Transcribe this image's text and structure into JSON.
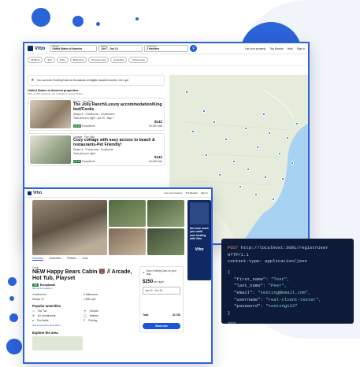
{
  "win1": {
    "logo": "Vrbo",
    "where_label": "Where",
    "where_value": "United States of America",
    "dates_label": "Dates",
    "dates_value": "Jun 7 - Jun 14",
    "travelers_label": "Travelers",
    "travelers_value": "2 travelers",
    "nav": [
      "List your property",
      "Trip Boards",
      "Help",
      "Sign in"
    ],
    "filters": [
      "All filters",
      "Sort",
      "Price",
      "Bedrooms",
      "Property type",
      "Amenities",
      "Instant book"
    ],
    "promo": "You can earn OneKeyCash on thousands of eligible vacation homes. Let's go!",
    "result_title": "United States of America properties",
    "result_sub": "300+ of 300 properties are available in United States",
    "cards": [
      {
        "type": "House · Two Tails",
        "title": "The Jolly Ranch/Luxury accommodation/King bed/Cooks",
        "sub": "Sleeps 8 · 3 bedrooms · 3 bathrooms",
        "meta": "Total price per night · Apr 30 - May 7",
        "badge": "Exceptional",
        "rating": "10/10",
        "price": "$142",
        "price_sub": "$1,000 total"
      },
      {
        "type": "Cottage · Two Tails",
        "title": "Cozy cottage with easy access to beach & restaurants-Pet Friendly!",
        "sub": "Sleeps 4 · 2 bedrooms · 1 bathroom",
        "meta": "Total price per night",
        "badge": "Exceptional",
        "rating": "10/10",
        "price": "$142",
        "price_sub": "$1,008 total"
      }
    ]
  },
  "win2": {
    "logo": "Vrbo",
    "nav": [
      "List your property",
      "Trip Boards",
      "Sign in"
    ],
    "tabs": [
      "Overview",
      "Amenities",
      "Policies",
      "Host"
    ],
    "category": "Cabin",
    "title": "NEW Happy Bears Cabin 🐻 // Arcade, Hot Tub, Playset",
    "badge": "Exceptional",
    "reviews": "See all 10 reviews >",
    "specs": [
      "4 bedrooms",
      "2 bathrooms",
      "Sleeps 12",
      "1,800 sq ft"
    ],
    "popular": "Popular amenities",
    "amenities": [
      "Hot Tub",
      "Kitchen",
      "Air conditioning",
      "Washer",
      "Pool table",
      "Parking"
    ],
    "see_all": "See all property amenities >",
    "explore": "Explore the area",
    "promo": "Earn OneKeyCash on your stay",
    "price": "$250",
    "price_sub": "per night",
    "dates": "Jun 12 - Jun 19",
    "total": "$1,780",
    "book": "Book now",
    "ad_text": "See how much you could earn hosting with Vrbo",
    "ad_logo": "Vrbo"
  },
  "code": {
    "method": "POST",
    "url": "http://localhost:3001/registrUser HTTP/1.1",
    "header": "content-type: application/json",
    "open": "{",
    "lines": [
      {
        "key": "\"first_name\"",
        "val": "\"Test\","
      },
      {
        "key": "\"last_name\"",
        "val": "\"Peer\","
      },
      {
        "key": "\"email\"",
        "val": "\"testing@email.com\","
      },
      {
        "key": "\"username\"",
        "val": "\"real-client-tester\","
      },
      {
        "key": "\"password\"",
        "val": "\"testing123\""
      }
    ],
    "close": "}",
    "end": "###"
  },
  "colors": {
    "accent": "#1c55d6",
    "brand": "#0b2a6b",
    "code_bg": "#0e1b38",
    "dot": "#2b63d9"
  }
}
